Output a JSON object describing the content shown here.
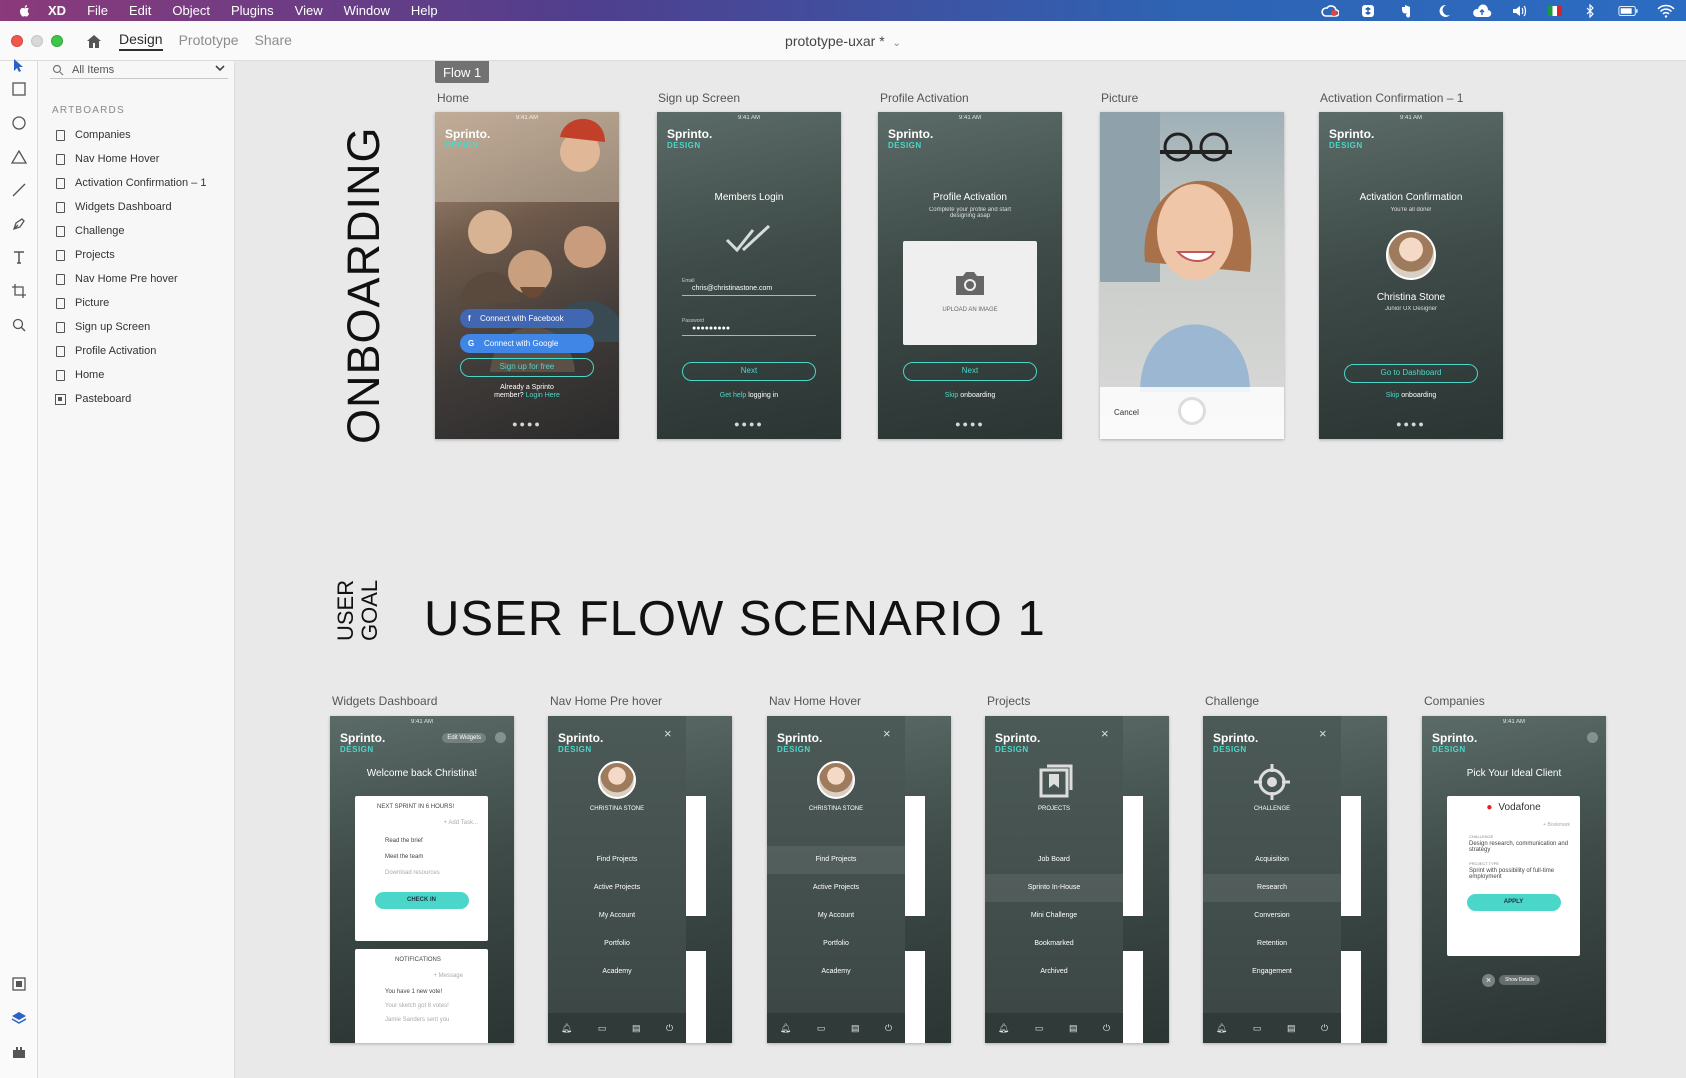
{
  "menubar": {
    "app": "XD",
    "items": [
      "File",
      "Edit",
      "Object",
      "Plugins",
      "View",
      "Window",
      "Help"
    ]
  },
  "toolbar": {
    "tabs": [
      "Design",
      "Prototype",
      "Share"
    ],
    "active_tab": "Design",
    "doc_title": "prototype-uxar *"
  },
  "layers": {
    "search_value": "All Items",
    "section_title": "ARTBOARDS",
    "items": [
      "Companies",
      "Nav Home Hover",
      "Activation Confirmation – 1",
      "Widgets Dashboard",
      "Challenge",
      "Projects",
      "Nav Home Pre hover",
      "Picture",
      "Sign up Screen",
      "Profile Activation",
      "Home",
      "Pasteboard"
    ]
  },
  "canvas": {
    "flow_tag": "Flow 1",
    "onboarding_title": "ONBOARDING",
    "user_goal_line1": "USER",
    "user_goal_line2": "GOAL",
    "scenario_title": "USER FLOW SCENARIO 1",
    "row1_labels": [
      "Home",
      "Sign up Screen",
      "Profile Activation",
      "Picture",
      "Activation Confirmation – 1"
    ],
    "row2_labels": [
      "Widgets Dashboard",
      "Nav Home Pre hover",
      "Nav Home Hover",
      "Projects",
      "Challenge",
      "Companies"
    ]
  },
  "screens": {
    "status_time": "9:41 AM",
    "logo": "Sprinto.",
    "logo_sub": "DESIGN",
    "home": {
      "fb": "Connect with Facebook",
      "google": "Connect with Google",
      "signup": "Sign up for free",
      "already": "Already a Sprinto",
      "member": "member?",
      "login": "Login Here"
    },
    "signup": {
      "heading": "Members Login",
      "email_label": "Email",
      "email_value": "chris@christinastone.com",
      "password_label": "Password",
      "password_value": "●●●●●●●●●",
      "next": "Next",
      "help_hl": "Get help",
      "help_rest": "logging in"
    },
    "profile": {
      "heading": "Profile Activation",
      "sub": "Complete your profile and start designing asap",
      "upload": "UPLOAD AN IMAGE",
      "next": "Next",
      "skip_hl": "Skip",
      "skip_rest": "onboarding"
    },
    "picture": {
      "cancel": "Cancel"
    },
    "activation": {
      "heading": "Activation Confirmation",
      "sub": "You're all done!",
      "name": "Christina Stone",
      "role": "Junior UX Designer",
      "cta": "Go to Dashboard",
      "skip_hl": "Skip",
      "skip_rest": "onboarding"
    },
    "widgets": {
      "edit": "Edit Widgets",
      "welcome": "Welcome back Christina!",
      "next_sprint": "NEXT SPRINT IN 6 HOURS!",
      "add_task": "+ Add Task...",
      "tasks": [
        "Read the brief",
        "Meet the team",
        "Download resources"
      ],
      "checkin": "CHECK IN",
      "notifications": "NOTIFICATIONS",
      "message": "+ Message",
      "notes": [
        "You have 1 new vote!",
        "Your sketch got 8 votes!",
        "Jamie Sanders sent you"
      ]
    },
    "nav": {
      "name": "CHRISTINA STONE",
      "items": [
        "Find Projects",
        "Active Projects",
        "My Account",
        "Portfolio",
        "Academy"
      ]
    },
    "projects": {
      "title": "PROJECTS",
      "items": [
        "Job Board",
        "Sprinto In-House",
        "Mini Challenge",
        "Bookmarked",
        "Archived"
      ]
    },
    "challenge": {
      "title": "CHALLENGE",
      "items": [
        "Acquisition",
        "Research",
        "Conversion",
        "Retention",
        "Engagement"
      ]
    },
    "companies": {
      "heading": "Pick Your Ideal Client",
      "company": "Vodafone",
      "bookmark": "+ Bookmark",
      "challenge_label": "CHALLENGE",
      "challenge_text": "Design research, communication and strategy",
      "type_label": "PROJECT TYPE",
      "type_text": "Sprint with possibility of full-time employment",
      "apply": "APPLY",
      "details": "Show Details"
    }
  }
}
